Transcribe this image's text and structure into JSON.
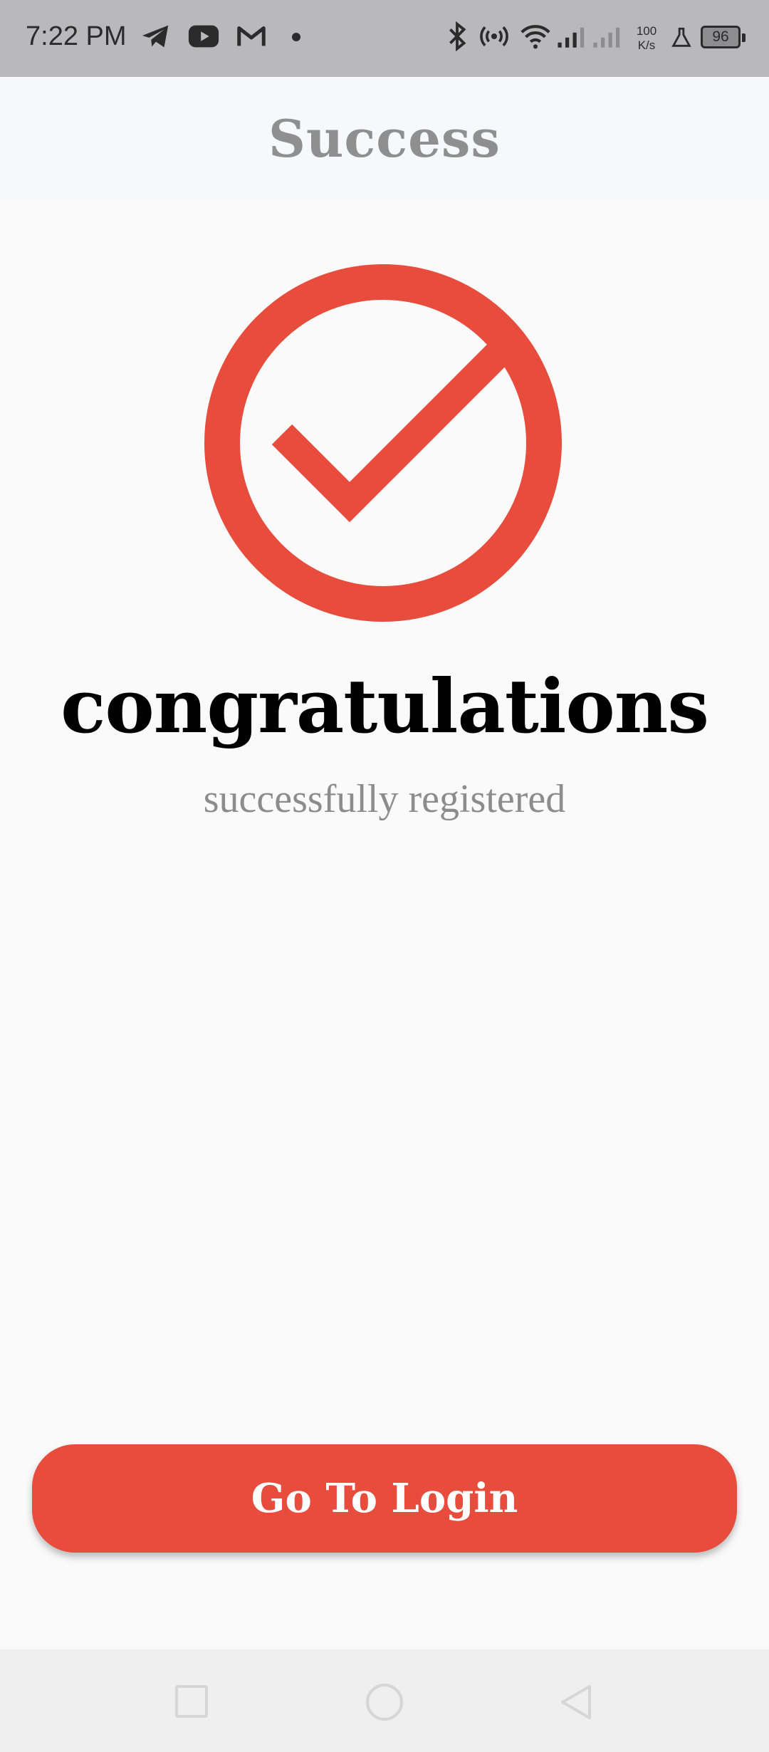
{
  "status_bar": {
    "time": "7:22 PM",
    "speed_value": "100",
    "speed_unit": "K/s",
    "battery": "96",
    "icons": [
      "telegram-icon",
      "youtube-icon",
      "gmail-icon",
      "bluetooth-icon",
      "hotspot-icon",
      "wifi-icon",
      "signal-icon",
      "signal-icon-2",
      "beaker-icon",
      "battery-icon"
    ]
  },
  "header": {
    "title": "Success"
  },
  "main": {
    "icon": "check-circle-icon",
    "heading": "congratulations",
    "subheading": "successfully registered"
  },
  "actions": {
    "login_label": "Go To Login"
  },
  "navbar": {
    "buttons": [
      "recent-apps",
      "home",
      "back"
    ]
  },
  "colors": {
    "accent": "#e74c3c",
    "header_bg": "#f7f8fb",
    "page_bg": "#fafafa",
    "status_bar_bg": "#b9b9bb"
  }
}
